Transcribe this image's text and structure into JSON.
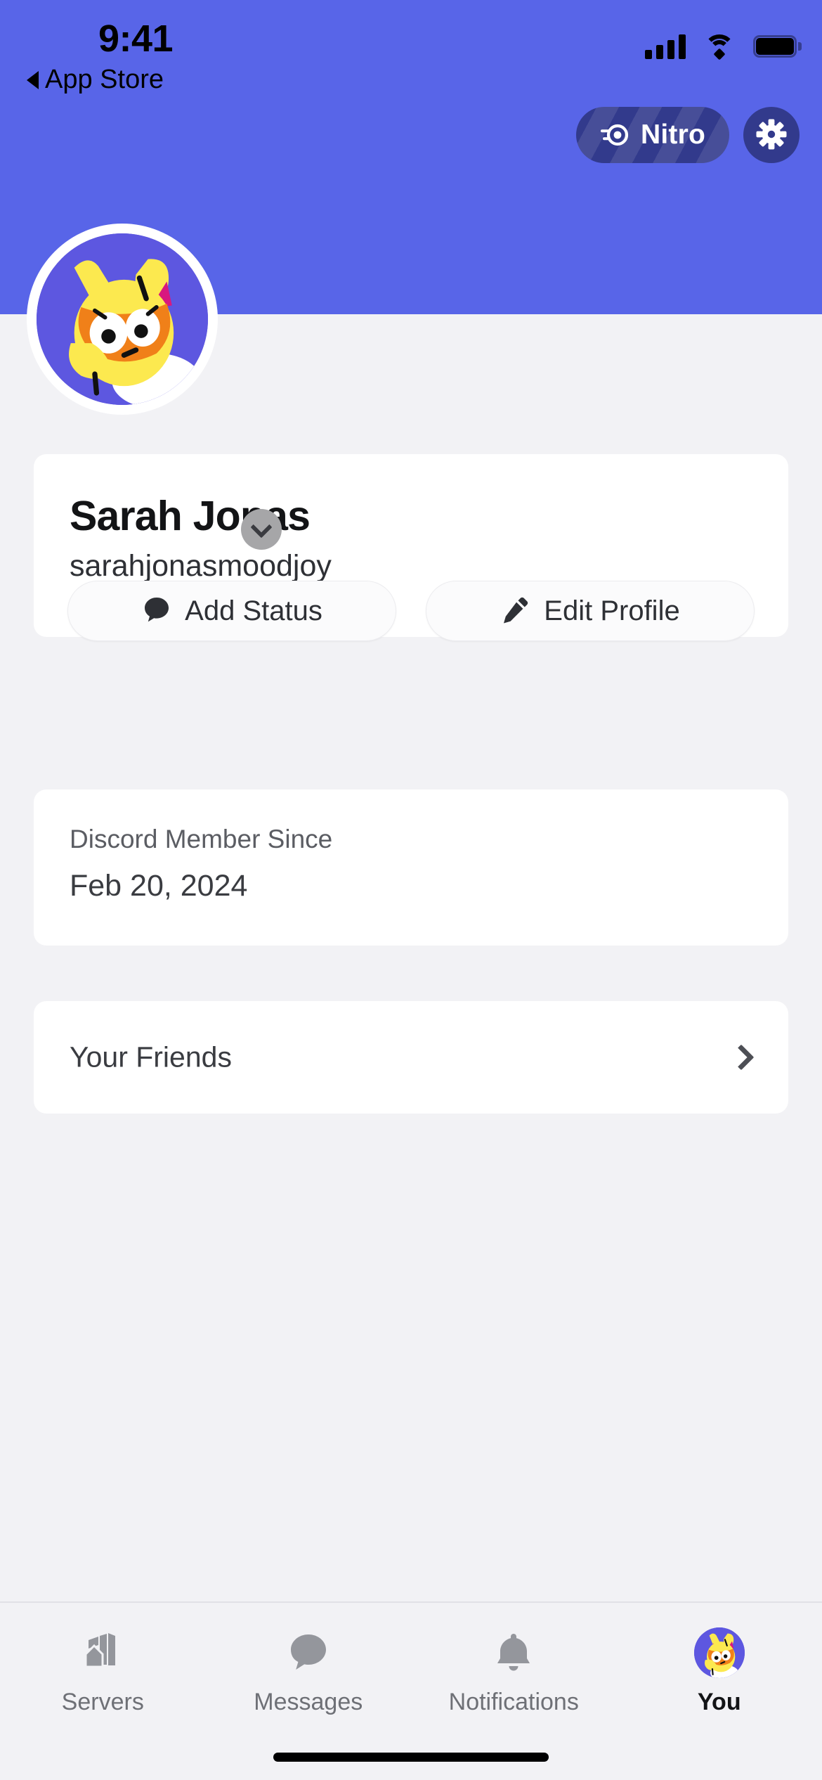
{
  "status_bar": {
    "time": "9:41",
    "back_label": "App Store",
    "back_icon": "triangle-left-icon",
    "cellular_icon": "cellular-signal-icon",
    "wifi_icon": "wifi-icon",
    "battery_icon": "battery-full-icon"
  },
  "header": {
    "background_color": "#5865E8",
    "nitro": {
      "label": "Nitro",
      "icon": "nitro-boost-icon",
      "background_color": "#323A8C"
    },
    "settings": {
      "icon": "gear-icon",
      "background_color": "#323A8C"
    }
  },
  "avatar": {
    "icon": "user-avatar-cat-icon",
    "background_color": "#5D57E0",
    "ring_color": "#FFFFFF"
  },
  "profile": {
    "display_name": "Sarah Jonas",
    "username": "sarahjonasmoodjoy",
    "status_badge_icon": "chevron-down-icon",
    "status_badge_color": "#A6A6A8",
    "actions": [
      {
        "label": "Add Status",
        "icon": "speech-bubble-icon"
      },
      {
        "label": "Edit Profile",
        "icon": "pencil-icon"
      }
    ]
  },
  "member_since": {
    "label": "Discord Member Since",
    "value": "Feb 20, 2024"
  },
  "friends": {
    "label": "Your Friends",
    "chevron_icon": "chevron-right-icon"
  },
  "tab_bar": {
    "tabs": [
      {
        "label": "Servers",
        "icon": "servers-buildings-icon",
        "active": false
      },
      {
        "label": "Messages",
        "icon": "speech-bubble-icon",
        "active": false
      },
      {
        "label": "Notifications",
        "icon": "bell-icon",
        "active": false
      },
      {
        "label": "You",
        "icon": "user-avatar-cat-icon",
        "active": true
      }
    ]
  },
  "colors": {
    "brand_purple": "#5865E8",
    "nitro_navy": "#323A8C",
    "page_background": "#F2F2F5",
    "card_background": "#FFFFFF"
  }
}
